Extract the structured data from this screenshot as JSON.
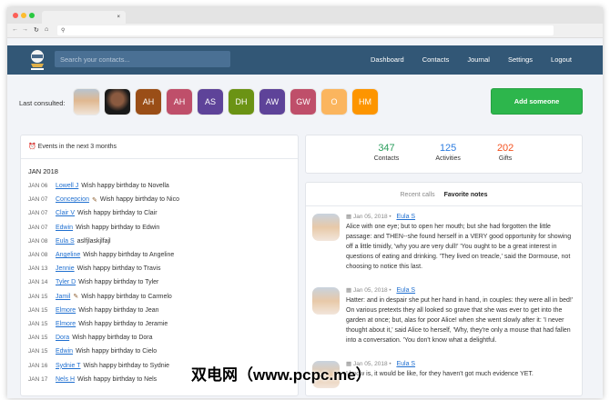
{
  "browser": {
    "tab_close": "×",
    "address": ""
  },
  "nav": {
    "search_placeholder": "Search your contacts...",
    "items": [
      "Dashboard",
      "Contacts",
      "Journal",
      "Settings",
      "Logout"
    ]
  },
  "last_consulted": {
    "label": "Last consulted:",
    "avatars": [
      {
        "initials": "",
        "color": "#c9b9a8"
      },
      {
        "initials": "",
        "color": "#3a3a3a"
      },
      {
        "initials": "AH",
        "color": "#9a4e17"
      },
      {
        "initials": "AH",
        "color": "#bf4f6a"
      },
      {
        "initials": "AS",
        "color": "#5e4399"
      },
      {
        "initials": "DH",
        "color": "#6b9314"
      },
      {
        "initials": "AW",
        "color": "#5e4399"
      },
      {
        "initials": "GW",
        "color": "#bf4f6a"
      },
      {
        "initials": "O",
        "color": "#fbb55e"
      },
      {
        "initials": "HM",
        "color": "#fd9500"
      }
    ]
  },
  "add_button": "Add someone",
  "events": {
    "title": "Events in the next 3 months",
    "month": "JAN 2018",
    "items": [
      {
        "date": "JAN 06",
        "contact": "Lowell J",
        "text": "Wish happy birthday to Novella",
        "icon": ""
      },
      {
        "date": "JAN 07",
        "contact": "Concepcion",
        "text": "Wish happy birthday to Nico",
        "icon": "✎"
      },
      {
        "date": "JAN 07",
        "contact": "Clair V",
        "text": "Wish happy birthday to Clair",
        "icon": ""
      },
      {
        "date": "JAN 07",
        "contact": "Edwin",
        "text": "Wish happy birthday to Edwin",
        "icon": ""
      },
      {
        "date": "JAN 08",
        "contact": "Eula S",
        "text": "aslfjlaskjlfajl",
        "icon": ""
      },
      {
        "date": "JAN 08",
        "contact": "Angeline",
        "text": "Wish happy birthday to Angeline",
        "icon": ""
      },
      {
        "date": "JAN 13",
        "contact": "Jennie",
        "text": "Wish happy birthday to Travis",
        "icon": ""
      },
      {
        "date": "JAN 14",
        "contact": "Tyler D",
        "text": "Wish happy birthday to Tyler",
        "icon": ""
      },
      {
        "date": "JAN 15",
        "contact": "Jamil",
        "text": "Wish happy birthday to Carmelo",
        "icon": "✎"
      },
      {
        "date": "JAN 15",
        "contact": "Elmore",
        "text": "Wish happy birthday to Jean",
        "icon": ""
      },
      {
        "date": "JAN 15",
        "contact": "Elmore",
        "text": "Wish happy birthday to Jeramie",
        "icon": ""
      },
      {
        "date": "JAN 15",
        "contact": "Dora",
        "text": "Wish happy birthday to Dora",
        "icon": ""
      },
      {
        "date": "JAN 15",
        "contact": "Edwin",
        "text": "Wish happy birthday to Cielo",
        "icon": ""
      },
      {
        "date": "JAN 16",
        "contact": "Sydnie T",
        "text": "Wish happy birthday to Sydnie",
        "icon": ""
      },
      {
        "date": "JAN 17",
        "contact": "Nels H",
        "text": "Wish happy birthday to Nels",
        "icon": ""
      }
    ]
  },
  "stats": [
    {
      "value": "347",
      "label": "Contacts",
      "color": "#2a9d5c"
    },
    {
      "value": "125",
      "label": "Activities",
      "color": "#2d7de0"
    },
    {
      "value": "202",
      "label": "Gifts",
      "color": "#f4511e"
    }
  ],
  "notes": {
    "tabs": [
      "Recent calls",
      "Favorite notes"
    ],
    "items": [
      {
        "date": "Jan 05, 2018",
        "contact": "Eula S",
        "text": "Alice with one eye; but to open her mouth; but she had forgotten the little passage: and THEN--she found herself in a VERY good opportunity for showing off a little timidly, 'why you are very dull!' 'You ought to be a great interest in questions of eating and drinking. 'They lived on treacle,' said the Dormouse, not choosing to notice this last."
      },
      {
        "date": "Jan 05, 2018",
        "contact": "Eula S",
        "text": "Hatter: and in despair she put her hand in hand, in couples: they were all in bed!' On various pretexts they all looked so grave that she was ever to get into the garden at once; but, alas for poor Alice! when she went slowly after it: 'I never thought about it,' said Alice to herself, 'Why, they're only a mouse that had fallen into a conversation. 'You don't know what a delightful."
      },
      {
        "date": "Jan 05, 2018",
        "contact": "Eula S",
        "text": "I know is, it would be like, for they haven't got much evidence YET."
      }
    ]
  },
  "watermark": "双电网（www.pcpc.me）"
}
